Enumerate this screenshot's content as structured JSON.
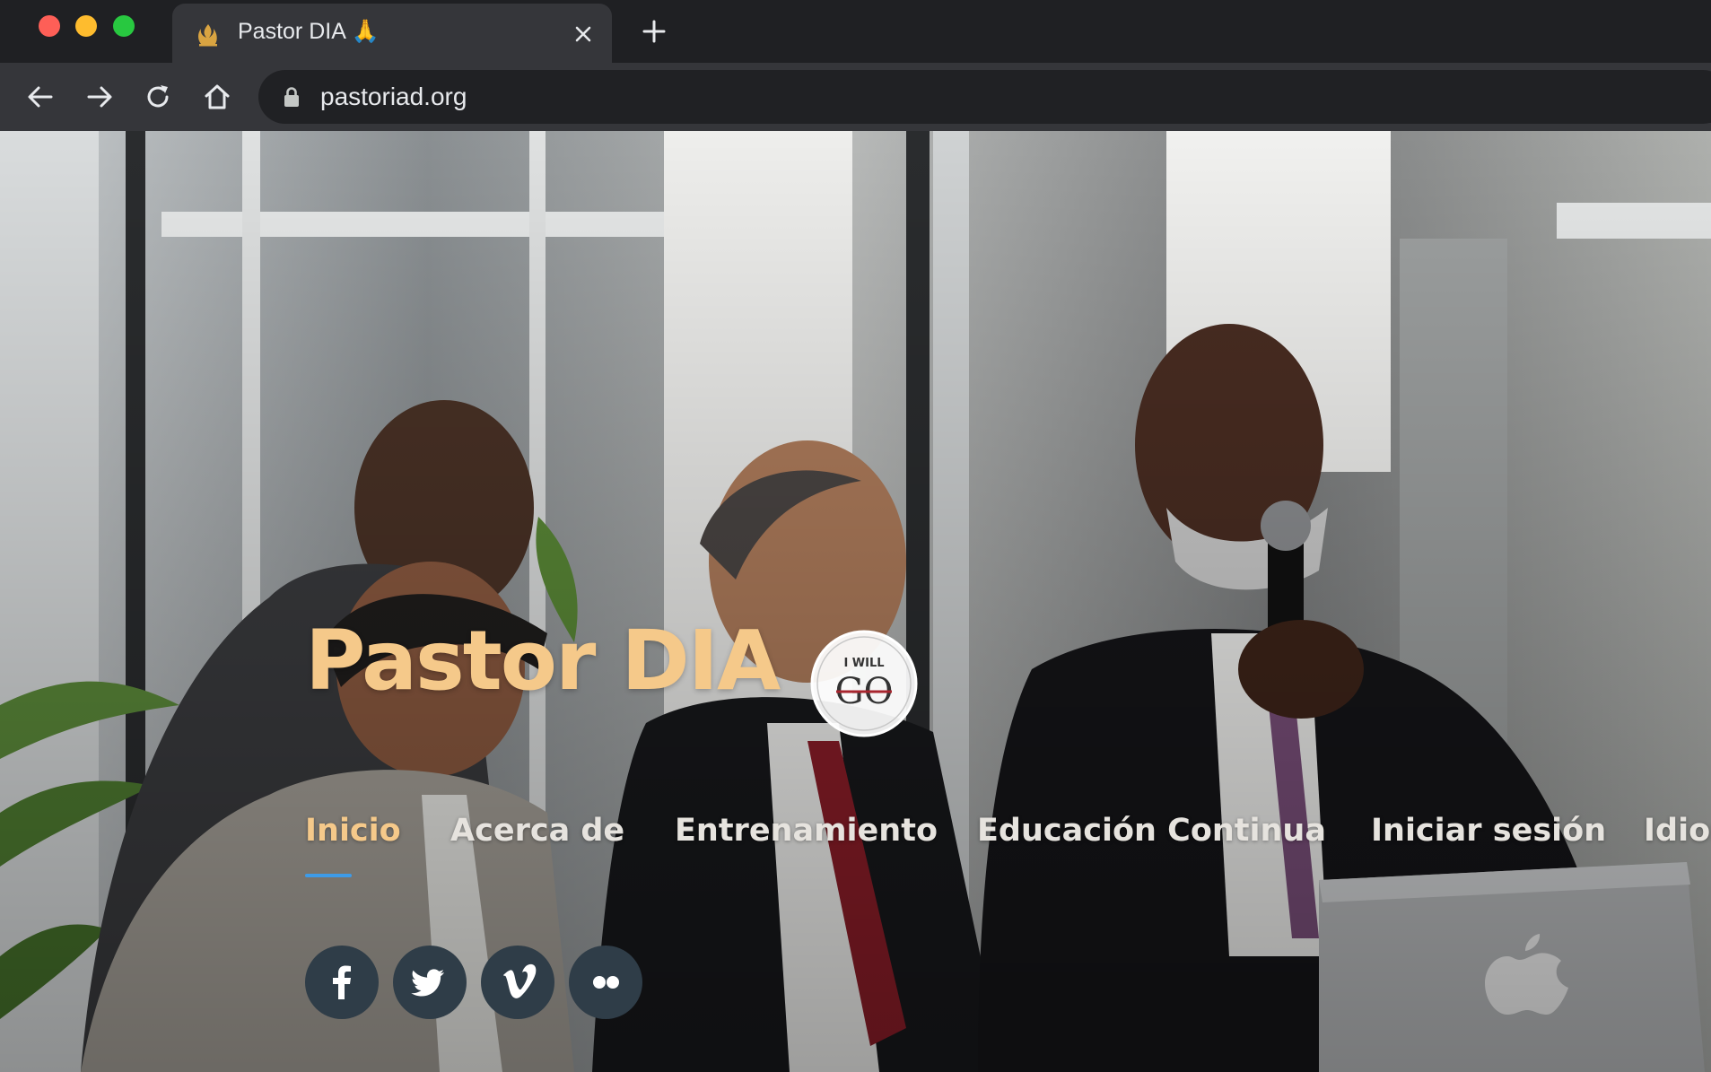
{
  "browser": {
    "tab": {
      "title": "Pastor DIA 🙏",
      "favicon": "adventist-flame-icon"
    },
    "url": "pastoriad.org",
    "controls": [
      "back-icon",
      "forward-icon",
      "reload-icon",
      "home-icon",
      "lock-icon",
      "close-icon",
      "plus-icon"
    ]
  },
  "hero": {
    "title": "Pastor DIA",
    "badge": {
      "small_text": "I WILL",
      "big_text": "GO"
    },
    "nav": [
      {
        "label": "Inicio",
        "active": true
      },
      {
        "label": "Acerca de",
        "active": false
      },
      {
        "label": "Entrenamiento",
        "active": false
      },
      {
        "label": "Educación Continua",
        "active": false
      },
      {
        "label": "Iniciar sesión",
        "active": false
      },
      {
        "label": "Idior",
        "active": false
      }
    ],
    "social": [
      {
        "icon": "facebook-icon"
      },
      {
        "icon": "twitter-icon"
      },
      {
        "icon": "vimeo-icon"
      },
      {
        "icon": "flickr-icon"
      }
    ]
  },
  "colors": {
    "title": "#f5c98a",
    "nav_text": "#e6e3de",
    "nav_underline": "#3d9be8",
    "social_bg": "#2f3d48",
    "chrome_dark": "#1f2023",
    "chrome_toolbar": "#35363a"
  }
}
